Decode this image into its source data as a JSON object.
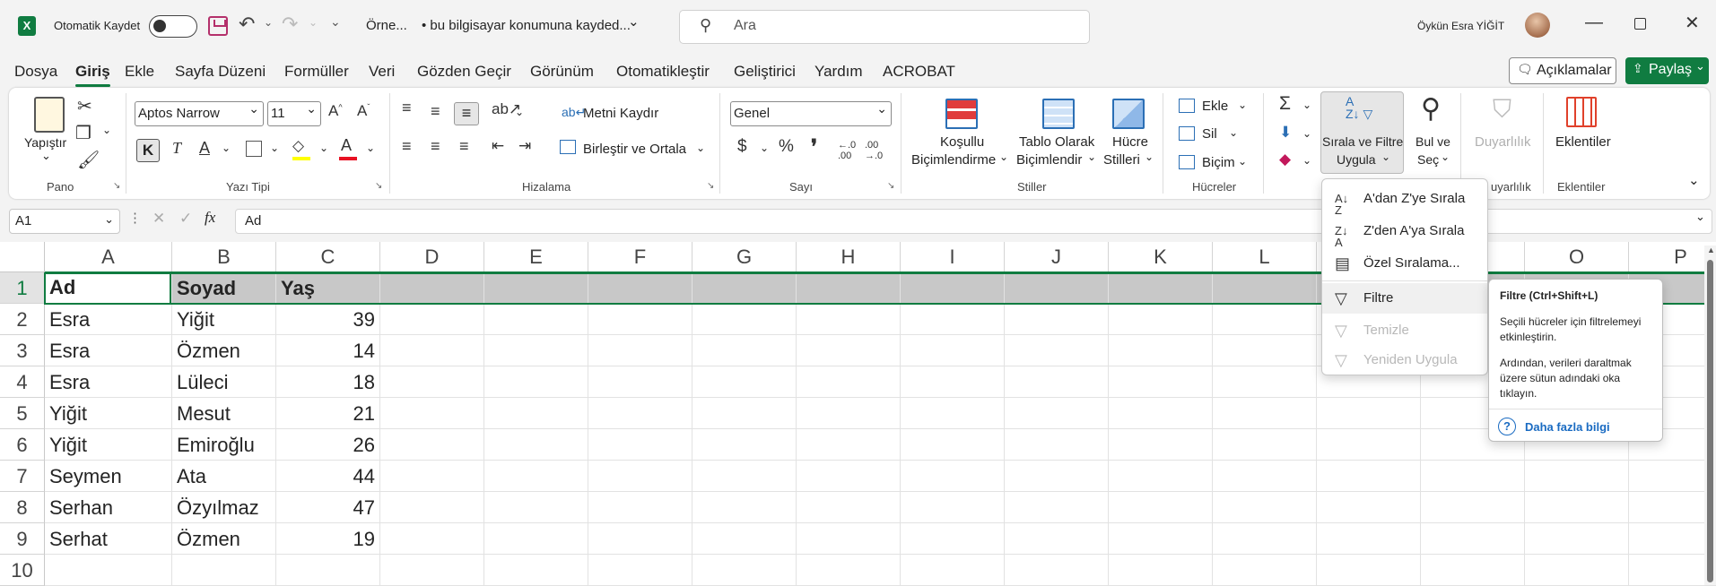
{
  "titlebar": {
    "app_icon": "excel-logo",
    "autosave_label": "Otomatik Kaydet",
    "file_name": "Örne...",
    "save_status": "• bu bilgisayar konumuna kayded...",
    "search_placeholder": "Ara",
    "user_name": "Öykün Esra YİĞİT"
  },
  "menu": {
    "items": [
      "Dosya",
      "Giriş",
      "Ekle",
      "Sayfa Düzeni",
      "Formüller",
      "Veri",
      "Gözden Geçir",
      "Görünüm",
      "Otomatikleştir",
      "Geliştirici",
      "Yardım",
      "ACROBAT"
    ],
    "active": "Giriş",
    "comments": "Açıklamalar",
    "share": "Paylaş"
  },
  "ribbon": {
    "clipboard": {
      "paste": "Yapıştır",
      "group": "Pano"
    },
    "font": {
      "name": "Aptos Narrow",
      "size": "11",
      "bold": "K",
      "italic": "T",
      "underline": "A",
      "group": "Yazı Tipi",
      "fill_color": "#ffff00",
      "font_color": "#e81123"
    },
    "alignment": {
      "wrap": "Metni Kaydır",
      "merge": "Birleştir ve Ortala",
      "group": "Hizalama"
    },
    "number": {
      "format": "Genel",
      "currency": "$",
      "percent": "%",
      "comma": "❜",
      "group": "Sayı"
    },
    "styles": {
      "conditional_1": "Koşullu",
      "conditional_2": "Biçimlendirme",
      "table_1": "Tablo Olarak",
      "table_2": "Biçimlendir",
      "cell_1": "Hücre",
      "cell_2": "Stilleri",
      "group": "Stiller"
    },
    "cells": {
      "insert": "Ekle",
      "delete": "Sil",
      "format": "Biçim",
      "group": "Hücreler"
    },
    "editing": {
      "sort_filter_1": "Sırala ve Filtre",
      "sort_filter_2": "Uygula",
      "find_1": "Bul ve",
      "find_2": "Seç"
    },
    "sensitivity": {
      "label": "Duyarlılık",
      "group": "uyarlılık"
    },
    "addins": {
      "label": "Eklentiler",
      "group": "Eklentiler"
    }
  },
  "formula_bar": {
    "name_box": "A1",
    "fx": "fx",
    "value": "Ad"
  },
  "columns": [
    "A",
    "B",
    "C",
    "D",
    "E",
    "F",
    "G",
    "H",
    "I",
    "J",
    "K",
    "L",
    "M",
    "N",
    "O",
    "P"
  ],
  "rows": [
    "1",
    "2",
    "3",
    "4",
    "5",
    "6",
    "7",
    "8",
    "9",
    "10"
  ],
  "table": {
    "headers": [
      "Ad",
      "Soyad",
      "Yaş"
    ],
    "rows": [
      [
        "Esra",
        "Yiğit",
        "39"
      ],
      [
        "Esra",
        "Özmen",
        "14"
      ],
      [
        "Esra",
        "Lüleci",
        "18"
      ],
      [
        "Yiğit",
        "Mesut",
        "21"
      ],
      [
        "Yiğit",
        "Emiroğlu",
        "26"
      ],
      [
        "Seymen",
        "Ata",
        "44"
      ],
      [
        "Serhan",
        "Özyılmaz",
        "47"
      ],
      [
        "Serhat",
        "Özmen",
        "19"
      ]
    ]
  },
  "sort_menu": {
    "items": [
      {
        "label": "A'dan Z'ye Sırala",
        "icon": "sort-az-icon",
        "disabled": false
      },
      {
        "label": "Z'den A'ya Sırala",
        "icon": "sort-za-icon",
        "disabled": false
      },
      {
        "label": "Özel Sıralama...",
        "icon": "custom-sort-icon",
        "disabled": false
      },
      {
        "label": "Filtre",
        "icon": "filter-icon",
        "disabled": false
      },
      {
        "label": "Temizle",
        "icon": "clear-filter-icon",
        "disabled": true
      },
      {
        "label": "Yeniden Uygula",
        "icon": "reapply-icon",
        "disabled": true
      }
    ]
  },
  "tooltip": {
    "title": "Filtre (Ctrl+Shift+L)",
    "line1": "Seçili hücreler için filtrelemeyi etkinleştirin.",
    "line2": "Ardından, verileri daraltmak üzere sütun adındaki oka tıklayın.",
    "more": "Daha fazla bilgi"
  }
}
